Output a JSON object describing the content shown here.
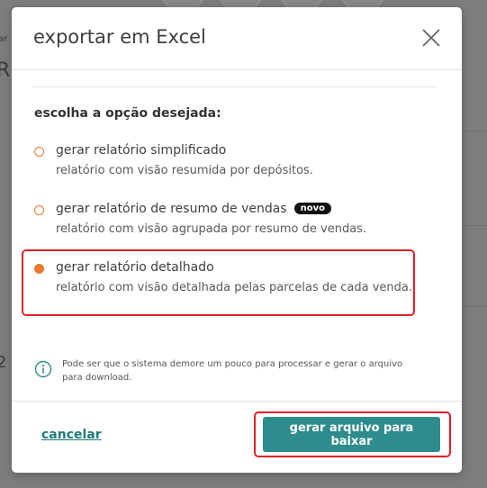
{
  "modal": {
    "title": "exportar em Excel",
    "section_label": "escolha a opção desejada:",
    "options": [
      {
        "title": "gerar relatório simplificado",
        "description": "relatório com visão resumida por depósitos.",
        "selected": false,
        "badge": ""
      },
      {
        "title": "gerar relatório de resumo de vendas",
        "description": "relatório com visão agrupada por resumo de vendas.",
        "selected": false,
        "badge": "novo"
      },
      {
        "title": "gerar relatório detalhado",
        "description": "relatório com visão detalhada pelas parcelas de cada venda.",
        "selected": true,
        "badge": ""
      }
    ],
    "info_text": "Pode ser que o sistema demore um pouco para processar e gerar o arquivo para download.",
    "cancel_label": "cancelar",
    "submit_label": "gerar arquivo para baixar",
    "icons": {
      "close": "close-icon",
      "info": "info-icon"
    }
  },
  "background": {
    "fragment_small": "ar",
    "fragment_big": "R",
    "fragment_digit": "2"
  },
  "colors": {
    "accent_orange": "#ec7a2e",
    "primary_teal": "#2e8c8c",
    "link_teal": "#1f7a7a",
    "highlight_red": "#e0202a",
    "badge_black": "#111111"
  }
}
